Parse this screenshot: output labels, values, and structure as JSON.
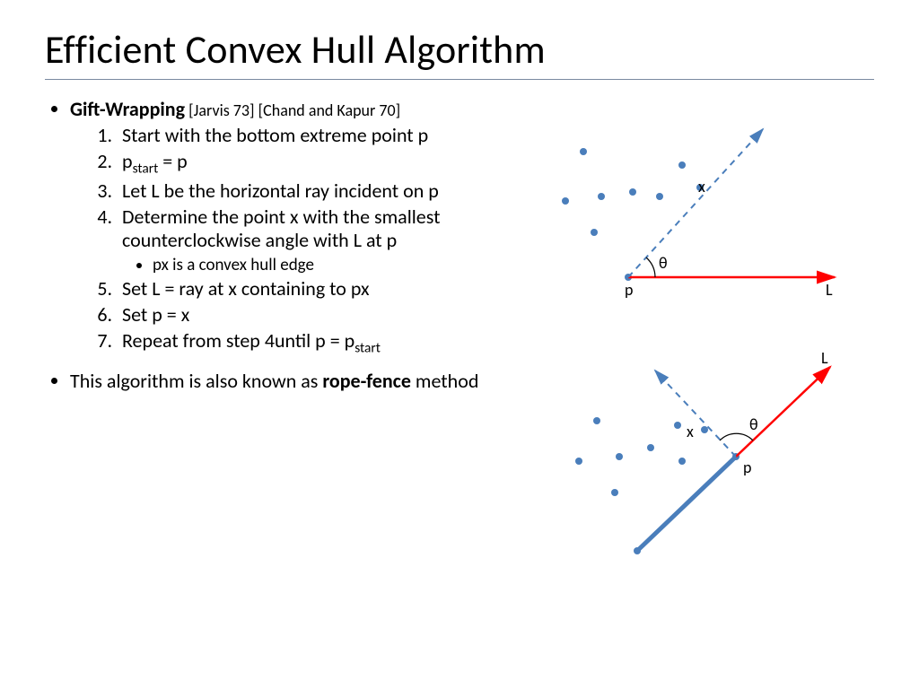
{
  "title": "Efficient Convex Hull Algorithm",
  "bullet1": {
    "heading": "Gift-Wrapping",
    "refs": " [Jarvis 73] [Chand and Kapur 70]",
    "steps": {
      "s1": "Start with the bottom extreme point p",
      "s2a": " p",
      "s2b": "start",
      "s2c": " = p",
      "s3": "Let L be the horizontal ray incident on p",
      "s4": "Determine the point x with the smallest counterclockwise angle with L at p",
      "s4sub": "px is a convex hull edge",
      "s5": "Set L = ray at x containing to px",
      "s6": "Set p = x",
      "s7a": "Repeat from step 4until  p = p",
      "s7b": "start"
    }
  },
  "bullet2a": "This algorithm is also  known as ",
  "bullet2b": "rope-fence",
  "bullet2c": " method",
  "diagram1": {
    "label_p": "p",
    "label_L": "L",
    "label_x": "x",
    "label_theta": "θ"
  },
  "diagram2": {
    "label_p": "p",
    "label_L": "L",
    "label_x": "x",
    "label_theta": "θ"
  }
}
